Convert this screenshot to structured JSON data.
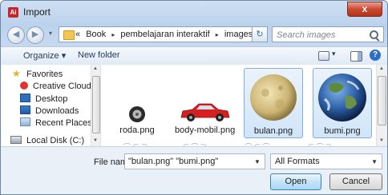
{
  "window": {
    "title": "Import",
    "app_icon": "Ai",
    "close_glyph": "x"
  },
  "nav": {
    "back_glyph": "◀",
    "forward_glyph": "▶",
    "dropdown_glyph": "▾"
  },
  "address": {
    "prefix": "«",
    "crumbs": [
      "Book",
      "pembelajaran interaktif",
      "images"
    ],
    "separator": "▸",
    "dropdown_glyph": "▾",
    "refresh_glyph": "↻"
  },
  "search": {
    "placeholder": "Search images"
  },
  "toolbar": {
    "organize": "Organize ▾",
    "new_folder": "New folder",
    "view_dropdown": "▾",
    "help": "?"
  },
  "sidebar": {
    "items": [
      {
        "label": "Favorites",
        "icon": "star-icon"
      },
      {
        "label": "Creative Cloud",
        "icon": "creative-cloud-icon"
      },
      {
        "label": "Desktop",
        "icon": "desktop-icon"
      },
      {
        "label": "Downloads",
        "icon": "downloads-icon"
      },
      {
        "label": "Recent Places",
        "icon": "recent-places-icon"
      },
      {
        "label": "Local Disk (C:)",
        "icon": "local-disk-icon"
      }
    ]
  },
  "files": [
    {
      "name": "roda.png",
      "selected": false,
      "icon": "wheel-image-icon"
    },
    {
      "name": "body-mobil.png",
      "selected": false,
      "icon": "car-image-icon"
    },
    {
      "name": "bulan.png",
      "selected": true,
      "icon": "moon-image-icon"
    },
    {
      "name": "bumi.png",
      "selected": true,
      "icon": "earth-image-icon"
    }
  ],
  "bottom": {
    "file_name_label": "File name:",
    "file_name_value": "\"bulan.png\" \"bumi.png\"",
    "format": "All Formats",
    "open": "Open",
    "cancel": "Cancel"
  },
  "colors": {
    "accent": "#3c7fb1",
    "selection": "#d1e5f9",
    "close": "#c94a31"
  }
}
